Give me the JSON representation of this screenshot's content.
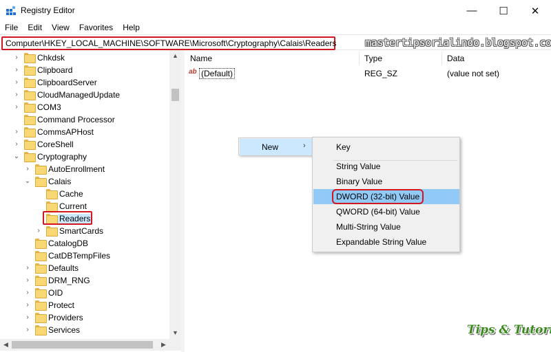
{
  "window": {
    "title": "Registry Editor",
    "minimize": "—",
    "maximize": "☐",
    "close": "✕"
  },
  "menu": [
    "File",
    "Edit",
    "View",
    "Favorites",
    "Help"
  ],
  "address": "Computer\\HKEY_LOCAL_MACHINE\\SOFTWARE\\Microsoft\\Cryptography\\Calais\\Readers",
  "watermark": "mastertipsorialindo.blogspot.com",
  "tree": [
    {
      "label": "Chkdsk",
      "level": 0,
      "arrow": "›"
    },
    {
      "label": "Clipboard",
      "level": 0,
      "arrow": "›"
    },
    {
      "label": "ClipboardServer",
      "level": 0,
      "arrow": "›"
    },
    {
      "label": "CloudManagedUpdate",
      "level": 0,
      "arrow": "›"
    },
    {
      "label": "COM3",
      "level": 0,
      "arrow": "›"
    },
    {
      "label": "Command Processor",
      "level": 0,
      "arrow": ""
    },
    {
      "label": "CommsAPHost",
      "level": 0,
      "arrow": "›"
    },
    {
      "label": "CoreShell",
      "level": 0,
      "arrow": "›"
    },
    {
      "label": "Cryptography",
      "level": 0,
      "arrow": "⌄"
    },
    {
      "label": "AutoEnrollment",
      "level": 1,
      "arrow": "›"
    },
    {
      "label": "Calais",
      "level": 1,
      "arrow": "⌄"
    },
    {
      "label": "Cache",
      "level": 2,
      "arrow": ""
    },
    {
      "label": "Current",
      "level": 2,
      "arrow": ""
    },
    {
      "label": "Readers",
      "level": 2,
      "arrow": "",
      "selected": true
    },
    {
      "label": "SmartCards",
      "level": 2,
      "arrow": "›"
    },
    {
      "label": "CatalogDB",
      "level": 1,
      "arrow": ""
    },
    {
      "label": "CatDBTempFiles",
      "level": 1,
      "arrow": ""
    },
    {
      "label": "Defaults",
      "level": 1,
      "arrow": "›"
    },
    {
      "label": "DRM_RNG",
      "level": 1,
      "arrow": "›"
    },
    {
      "label": "OID",
      "level": 1,
      "arrow": "›"
    },
    {
      "label": "Protect",
      "level": 1,
      "arrow": "›"
    },
    {
      "label": "Providers",
      "level": 1,
      "arrow": "›"
    },
    {
      "label": "Services",
      "level": 1,
      "arrow": "›"
    }
  ],
  "columns": {
    "name": "Name",
    "type": "Type",
    "data": "Data"
  },
  "values": [
    {
      "icon": "ab",
      "name": "(Default)",
      "type": "REG_SZ",
      "data": "(value not set)"
    }
  ],
  "context_menu": {
    "parent_label": "New",
    "parent_chevron": "›",
    "items": [
      "Key",
      "String Value",
      "Binary Value",
      "DWORD (32-bit) Value",
      "QWORD (64-bit) Value",
      "Multi-String Value",
      "Expandable String Value"
    ],
    "highlighted_index": 3
  },
  "logo": "Tips & Tutorial"
}
